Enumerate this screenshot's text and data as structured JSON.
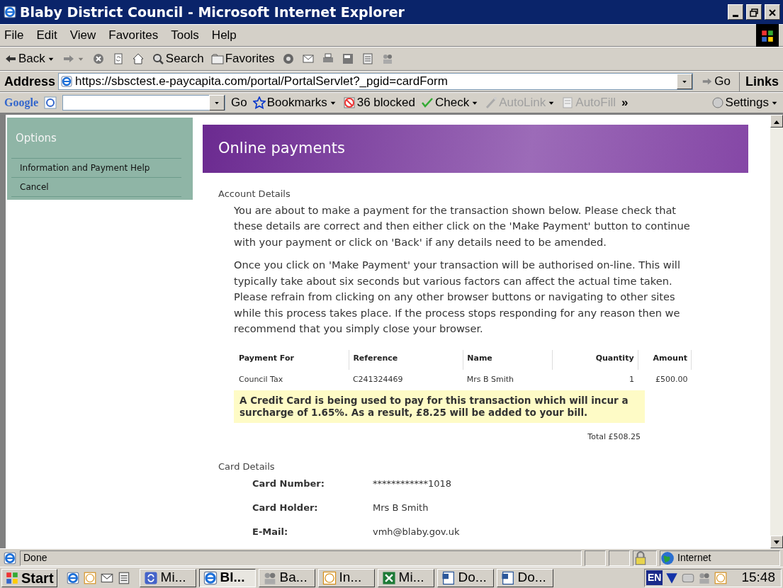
{
  "window": {
    "title": "Blaby District Council - Microsoft Internet Explorer"
  },
  "menu": [
    "File",
    "Edit",
    "View",
    "Favorites",
    "Tools",
    "Help"
  ],
  "toolbar": {
    "back": "Back",
    "search": "Search",
    "favorites": "Favorites"
  },
  "address": {
    "label": "Address",
    "value": "https://sbsctest.e-paycapita.com/portal/PortalServlet?_pgid=cardForm",
    "go": "Go",
    "links": "Links"
  },
  "google_logo": "Google",
  "google_bar": [
    {
      "kind": "go",
      "label": "Go",
      "disabled": false
    },
    {
      "kind": "bookmarks",
      "label": "Bookmarks",
      "disabled": false
    },
    {
      "kind": "blocked",
      "label": "36 blocked",
      "disabled": false
    },
    {
      "kind": "check",
      "label": "Check",
      "disabled": false
    },
    {
      "kind": "autolink",
      "label": "AutoLink",
      "disabled": true
    },
    {
      "kind": "autofill",
      "label": "AutoFill",
      "disabled": true
    },
    {
      "kind": "more",
      "label": "»",
      "disabled": false
    },
    {
      "kind": "settings",
      "label": "Settings",
      "disabled": false
    }
  ],
  "sidebar": {
    "title": "Options",
    "items": [
      "Information and Payment Help",
      "Cancel"
    ]
  },
  "page": {
    "header": "Online payments",
    "account_title": "Account Details",
    "paragraphs": [
      "You are about to make a payment for the transaction shown below. Please check that these details are correct and then either click on the 'Make Payment' button to continue with your payment or click on 'Back' if any details need to be amended.",
      "Once you click on 'Make Payment' your transaction will be authorised on-line. This will typically take about six seconds but various factors can affect the actual time taken. Please refrain from clicking on any other browser buttons or navigating to other sites while this process takes place. If the process stops responding for any reason then we recommend that you simply close your browser."
    ],
    "table": {
      "columns": [
        "Payment For",
        "Reference",
        "Name",
        "Quantity",
        "Amount"
      ],
      "rows": [
        [
          "Council Tax",
          "C241324469",
          "Mrs B Smith",
          "1",
          "£500.00"
        ]
      ]
    },
    "notice": "A Credit Card is being used to pay for this transaction which will incur a surcharge of 1.65%. As a result, £8.25 will be added to your bill.",
    "total": "Total £508.25",
    "card_title": "Card Details",
    "card_fields": [
      {
        "label": "Card Number:",
        "value": "************1018"
      },
      {
        "label": "Card Holder:",
        "value": "Mrs B Smith"
      },
      {
        "label": "E-Mail:",
        "value": "vmh@blaby.gov.uk"
      }
    ]
  },
  "status_bar": {
    "text": "Done",
    "zone": "Internet"
  },
  "taskbar": {
    "start": "Start",
    "tasks": [
      {
        "label": "Mi...",
        "selected": false
      },
      {
        "label": "Bl...",
        "selected": true
      },
      {
        "label": "Ba...",
        "selected": false
      },
      {
        "label": "In...",
        "selected": false
      },
      {
        "label": "Mi...",
        "selected": false
      },
      {
        "label": "Do...",
        "selected": false
      },
      {
        "label": "Do...",
        "selected": false
      }
    ],
    "language": "EN",
    "clock": "15:48"
  }
}
